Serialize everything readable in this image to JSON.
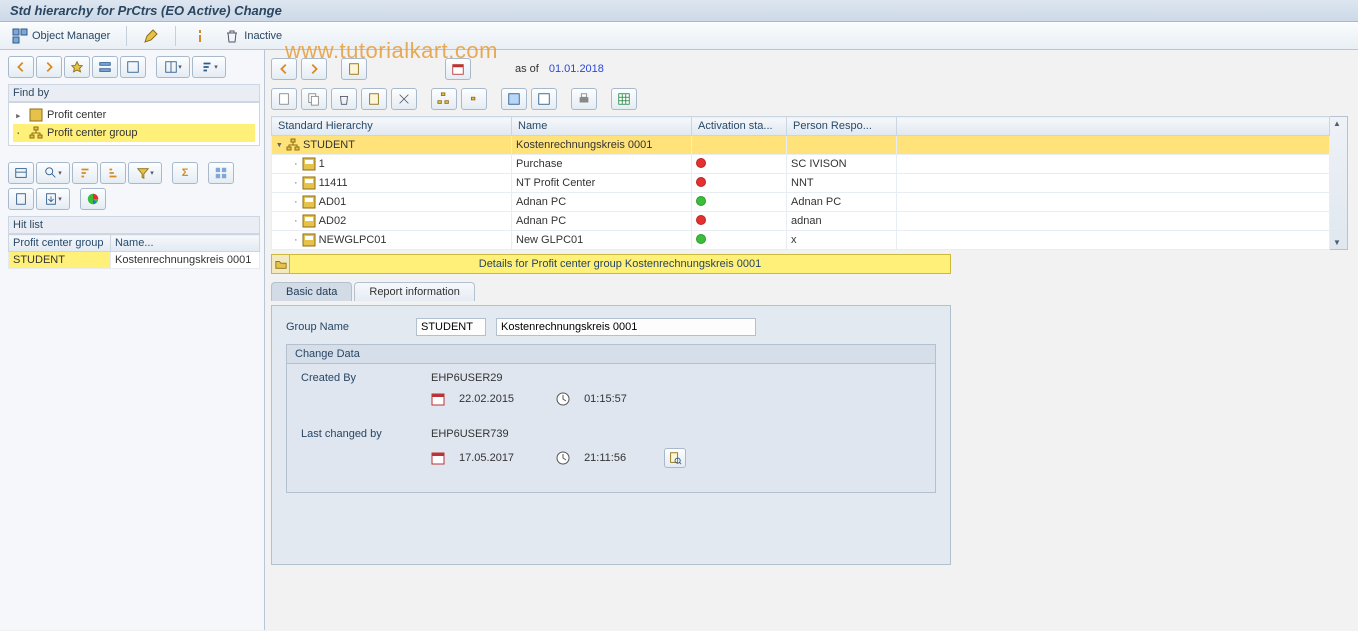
{
  "title": "Std hierarchy for PrCtrs (EO Active) Change",
  "watermark": "www.tutorialkart.com",
  "app_toolbar": {
    "object_manager": "Object Manager",
    "inactive": "Inactive"
  },
  "left": {
    "find_by": "Find by",
    "tree": [
      {
        "label": "Profit center",
        "type": "pc",
        "expanded": true,
        "selected": false
      },
      {
        "label": "Profit center group",
        "type": "pcg",
        "expanded": false,
        "selected": true
      }
    ],
    "hit_list_label": "Hit list",
    "hit_cols": {
      "col1": "Profit center group",
      "col2": "Name..."
    },
    "hit_rows": [
      {
        "group": "STUDENT",
        "name": "Kostenrechnungskreis 0001",
        "selected": true
      }
    ]
  },
  "right": {
    "asof_label": "as of",
    "asof_date": "01.01.2018",
    "grid_headers": {
      "h1": "Standard Hierarchy",
      "h2": "Name",
      "h3": "Activation sta...",
      "h4": "Person Respo..."
    },
    "rows": [
      {
        "level": 0,
        "type": "group",
        "code": "STUDENT",
        "name": "Kostenrechnungskreis 0001",
        "status": "",
        "person": "",
        "highlight": true,
        "expand": "▾"
      },
      {
        "level": 1,
        "type": "pc",
        "code": "1",
        "name": "Purchase",
        "status": "red",
        "person": "SC IVISON"
      },
      {
        "level": 1,
        "type": "pc",
        "code": "11411",
        "name": "NT Profit Center",
        "status": "red",
        "person": "NNT"
      },
      {
        "level": 1,
        "type": "pc",
        "code": "AD01",
        "name": "Adnan PC",
        "status": "green",
        "person": "Adnan PC"
      },
      {
        "level": 1,
        "type": "pc",
        "code": "AD02",
        "name": "Adnan PC",
        "status": "red",
        "person": "adnan"
      },
      {
        "level": 1,
        "type": "pc",
        "code": "NEWGLPC01",
        "name": "New GLPC01",
        "status": "green",
        "person": "x"
      }
    ],
    "details_bar": "Details for Profit center group Kostenrechnungskreis 0001",
    "tabs": {
      "basic": "Basic data",
      "report": "Report information"
    },
    "form": {
      "group_name_label": "Group Name",
      "group_name_code": "STUDENT",
      "group_name_desc": "Kostenrechnungskreis 0001",
      "change_data_hdr": "Change Data",
      "created_by_label": "Created By",
      "created_by": "EHP6USER29",
      "created_date": "22.02.2015",
      "created_time": "01:15:57",
      "last_changed_label": "Last changed by",
      "last_changed_by": "EHP6USER739",
      "last_changed_date": "17.05.2017",
      "last_changed_time": "21:11:56"
    }
  }
}
